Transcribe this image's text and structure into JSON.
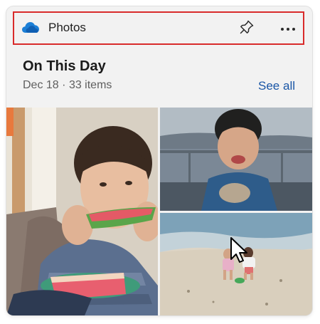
{
  "widget": {
    "app_name": "Photos",
    "icons": {
      "app": "onedrive-cloud-icon",
      "pin": "pin-icon",
      "more": "more-options-icon"
    },
    "title": "On This Day",
    "date": "Dec 18",
    "separator": "·",
    "item_count": "33 items",
    "see_all_label": "See all",
    "photos": [
      {
        "name": "child-eating-watermelon-photo"
      },
      {
        "name": "child-smiling-at-lake-photo"
      },
      {
        "name": "children-playing-on-beach-photo"
      }
    ]
  },
  "colors": {
    "accent": "#1a56a6",
    "highlight_border": "#d92b2b",
    "card_background": "#f2f2f2",
    "cloud_blue": "#1c7fd6"
  }
}
